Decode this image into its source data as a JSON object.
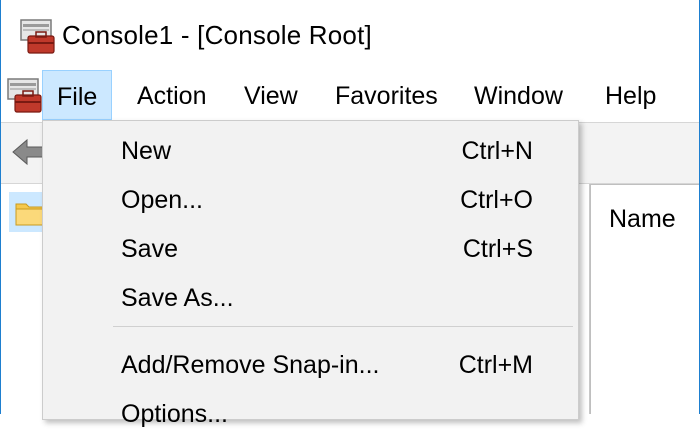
{
  "window": {
    "title": "Console1 - [Console Root]"
  },
  "menubar": {
    "items": [
      {
        "label": "File",
        "active": true
      },
      {
        "label": "Action"
      },
      {
        "label": "View"
      },
      {
        "label": "Favorites"
      },
      {
        "label": "Window"
      },
      {
        "label": "Help"
      }
    ]
  },
  "file_menu": {
    "items": [
      {
        "label": "New",
        "shortcut": "Ctrl+N"
      },
      {
        "label": "Open...",
        "shortcut": "Ctrl+O"
      },
      {
        "label": "Save",
        "shortcut": "Ctrl+S"
      },
      {
        "label": "Save As...",
        "shortcut": ""
      },
      {
        "label": "Add/Remove Snap-in...",
        "shortcut": "Ctrl+M"
      },
      {
        "label": "Options...",
        "shortcut": ""
      }
    ]
  },
  "result_pane": {
    "column_header": "Name"
  },
  "colors": {
    "accent": "#1e7fcf",
    "menu_highlight": "#cce8ff",
    "menu_bg": "#f2f2f2"
  },
  "icons": {
    "app": "mmc-toolbox-icon",
    "back": "back-arrow-icon",
    "folder": "folder-icon"
  }
}
